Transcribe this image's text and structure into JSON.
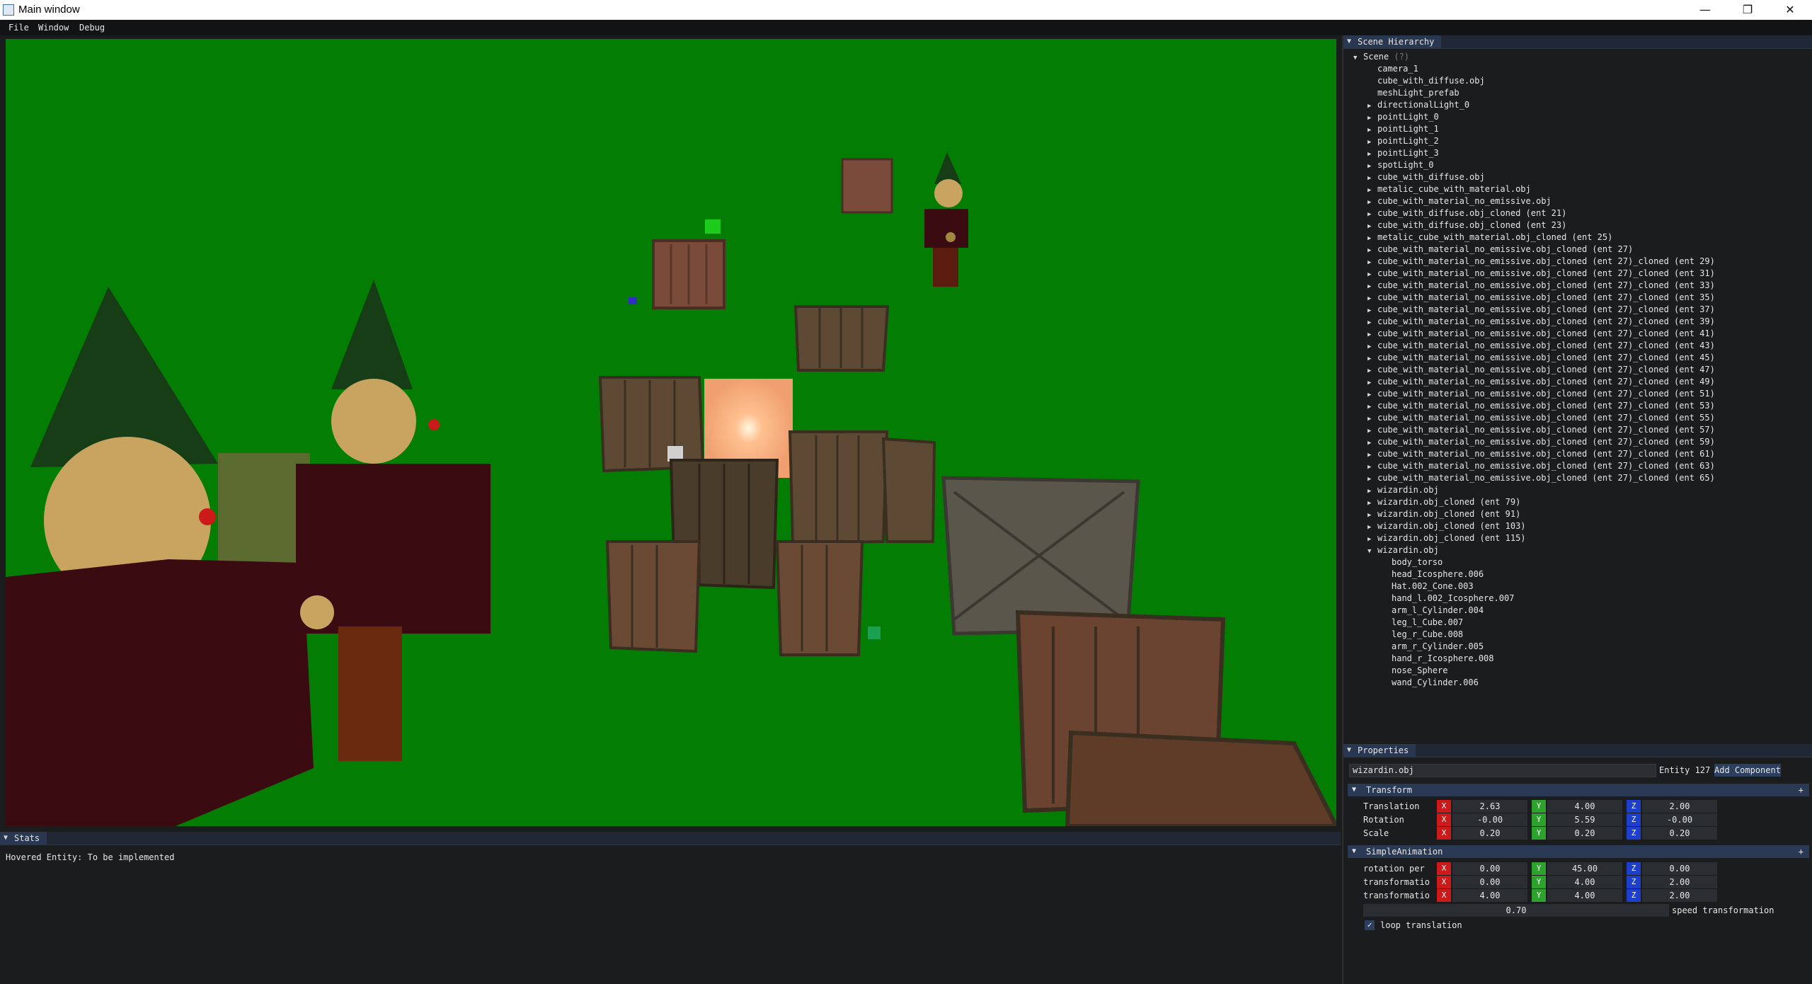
{
  "window": {
    "title": "Main window"
  },
  "menu": [
    "File",
    "Window",
    "Debug"
  ],
  "hierarchy": {
    "tab": "Scene Hierarchy",
    "rows": [
      {
        "label": "Scene",
        "depth": 0,
        "arrow": "open",
        "hint": "(?)"
      },
      {
        "label": "camera_1",
        "depth": 1,
        "arrow": ""
      },
      {
        "label": "cube_with_diffuse.obj",
        "depth": 1,
        "arrow": ""
      },
      {
        "label": "meshLight_prefab",
        "depth": 1,
        "arrow": ""
      },
      {
        "label": "directionalLight_0",
        "depth": 1,
        "arrow": "closed"
      },
      {
        "label": "pointLight_0",
        "depth": 1,
        "arrow": "closed"
      },
      {
        "label": "pointLight_1",
        "depth": 1,
        "arrow": "closed"
      },
      {
        "label": "pointLight_2",
        "depth": 1,
        "arrow": "closed"
      },
      {
        "label": "pointLight_3",
        "depth": 1,
        "arrow": "closed"
      },
      {
        "label": "spotLight_0",
        "depth": 1,
        "arrow": "closed"
      },
      {
        "label": "cube_with_diffuse.obj",
        "depth": 1,
        "arrow": "closed"
      },
      {
        "label": "metalic_cube_with_material.obj",
        "depth": 1,
        "arrow": "closed"
      },
      {
        "label": "cube_with_material_no_emissive.obj",
        "depth": 1,
        "arrow": "closed"
      },
      {
        "label": "cube_with_diffuse.obj_cloned (ent 21)",
        "depth": 1,
        "arrow": "closed"
      },
      {
        "label": "cube_with_diffuse.obj_cloned (ent 23)",
        "depth": 1,
        "arrow": "closed"
      },
      {
        "label": "metalic_cube_with_material.obj_cloned (ent 25)",
        "depth": 1,
        "arrow": "closed"
      },
      {
        "label": "cube_with_material_no_emissive.obj_cloned (ent 27)",
        "depth": 1,
        "arrow": "closed"
      },
      {
        "label": "cube_with_material_no_emissive.obj_cloned (ent 27)_cloned (ent 29)",
        "depth": 1,
        "arrow": "closed"
      },
      {
        "label": "cube_with_material_no_emissive.obj_cloned (ent 27)_cloned (ent 31)",
        "depth": 1,
        "arrow": "closed"
      },
      {
        "label": "cube_with_material_no_emissive.obj_cloned (ent 27)_cloned (ent 33)",
        "depth": 1,
        "arrow": "closed"
      },
      {
        "label": "cube_with_material_no_emissive.obj_cloned (ent 27)_cloned (ent 35)",
        "depth": 1,
        "arrow": "closed"
      },
      {
        "label": "cube_with_material_no_emissive.obj_cloned (ent 27)_cloned (ent 37)",
        "depth": 1,
        "arrow": "closed"
      },
      {
        "label": "cube_with_material_no_emissive.obj_cloned (ent 27)_cloned (ent 39)",
        "depth": 1,
        "arrow": "closed"
      },
      {
        "label": "cube_with_material_no_emissive.obj_cloned (ent 27)_cloned (ent 41)",
        "depth": 1,
        "arrow": "closed"
      },
      {
        "label": "cube_with_material_no_emissive.obj_cloned (ent 27)_cloned (ent 43)",
        "depth": 1,
        "arrow": "closed"
      },
      {
        "label": "cube_with_material_no_emissive.obj_cloned (ent 27)_cloned (ent 45)",
        "depth": 1,
        "arrow": "closed"
      },
      {
        "label": "cube_with_material_no_emissive.obj_cloned (ent 27)_cloned (ent 47)",
        "depth": 1,
        "arrow": "closed"
      },
      {
        "label": "cube_with_material_no_emissive.obj_cloned (ent 27)_cloned (ent 49)",
        "depth": 1,
        "arrow": "closed"
      },
      {
        "label": "cube_with_material_no_emissive.obj_cloned (ent 27)_cloned (ent 51)",
        "depth": 1,
        "arrow": "closed"
      },
      {
        "label": "cube_with_material_no_emissive.obj_cloned (ent 27)_cloned (ent 53)",
        "depth": 1,
        "arrow": "closed"
      },
      {
        "label": "cube_with_material_no_emissive.obj_cloned (ent 27)_cloned (ent 55)",
        "depth": 1,
        "arrow": "closed"
      },
      {
        "label": "cube_with_material_no_emissive.obj_cloned (ent 27)_cloned (ent 57)",
        "depth": 1,
        "arrow": "closed"
      },
      {
        "label": "cube_with_material_no_emissive.obj_cloned (ent 27)_cloned (ent 59)",
        "depth": 1,
        "arrow": "closed"
      },
      {
        "label": "cube_with_material_no_emissive.obj_cloned (ent 27)_cloned (ent 61)",
        "depth": 1,
        "arrow": "closed"
      },
      {
        "label": "cube_with_material_no_emissive.obj_cloned (ent 27)_cloned (ent 63)",
        "depth": 1,
        "arrow": "closed"
      },
      {
        "label": "cube_with_material_no_emissive.obj_cloned (ent 27)_cloned (ent 65)",
        "depth": 1,
        "arrow": "closed"
      },
      {
        "label": "wizardin.obj",
        "depth": 1,
        "arrow": "closed"
      },
      {
        "label": "wizardin.obj_cloned (ent 79)",
        "depth": 1,
        "arrow": "closed"
      },
      {
        "label": "wizardin.obj_cloned (ent 91)",
        "depth": 1,
        "arrow": "closed"
      },
      {
        "label": "wizardin.obj_cloned (ent 103)",
        "depth": 1,
        "arrow": "closed"
      },
      {
        "label": "wizardin.obj_cloned (ent 115)",
        "depth": 1,
        "arrow": "closed"
      },
      {
        "label": "wizardin.obj",
        "depth": 1,
        "arrow": "open"
      },
      {
        "label": "body_torso",
        "depth": 2,
        "arrow": ""
      },
      {
        "label": "head_Icosphere.006",
        "depth": 2,
        "arrow": ""
      },
      {
        "label": "Hat.002_Cone.003",
        "depth": 2,
        "arrow": ""
      },
      {
        "label": "hand_l.002_Icosphere.007",
        "depth": 2,
        "arrow": ""
      },
      {
        "label": "arm_l_Cylinder.004",
        "depth": 2,
        "arrow": ""
      },
      {
        "label": "leg_l_Cube.007",
        "depth": 2,
        "arrow": ""
      },
      {
        "label": "leg_r_Cube.008",
        "depth": 2,
        "arrow": ""
      },
      {
        "label": "arm_r_Cylinder.005",
        "depth": 2,
        "arrow": ""
      },
      {
        "label": "hand_r_Icosphere.008",
        "depth": 2,
        "arrow": ""
      },
      {
        "label": "nose_Sphere",
        "depth": 2,
        "arrow": ""
      },
      {
        "label": "wand_Cylinder.006",
        "depth": 2,
        "arrow": ""
      }
    ]
  },
  "properties": {
    "tab": "Properties",
    "name_value": "wizardin.obj",
    "entity": "Entity 127",
    "add_component": "Add Component",
    "transform": {
      "title": "Transform",
      "plus": "+",
      "rows": [
        {
          "label": "Translation",
          "x": "2.63",
          "y": "4.00",
          "z": "2.00"
        },
        {
          "label": "Rotation",
          "x": "-0.00",
          "y": "5.59",
          "z": "-0.00"
        },
        {
          "label": "Scale",
          "x": "0.20",
          "y": "0.20",
          "z": "0.20"
        }
      ]
    },
    "anim": {
      "title": "SimpleAnimation",
      "plus": "+",
      "rows": [
        {
          "label": "rotation per",
          "x": "0.00",
          "y": "45.00",
          "z": "0.00"
        },
        {
          "label": "transformatio",
          "x": "0.00",
          "y": "4.00",
          "z": "2.00"
        },
        {
          "label": "transformatio",
          "x": "4.00",
          "y": "4.00",
          "z": "2.00"
        }
      ],
      "speed_value": "0.70",
      "speed_label": "speed transformation",
      "loop_label": "loop translation",
      "loop_checked": true
    },
    "axis_letters": {
      "x": "X",
      "y": "Y",
      "z": "Z"
    }
  },
  "stats": {
    "tab": "Stats",
    "hovered": "Hovered Entity: To be implemented"
  },
  "colors": {
    "viewport_bg": "#037d03",
    "x_axis": "#cc1a1a",
    "y_axis": "#2da32d",
    "z_axis": "#1e3fcc",
    "panel_bg": "#1b1c1e"
  }
}
